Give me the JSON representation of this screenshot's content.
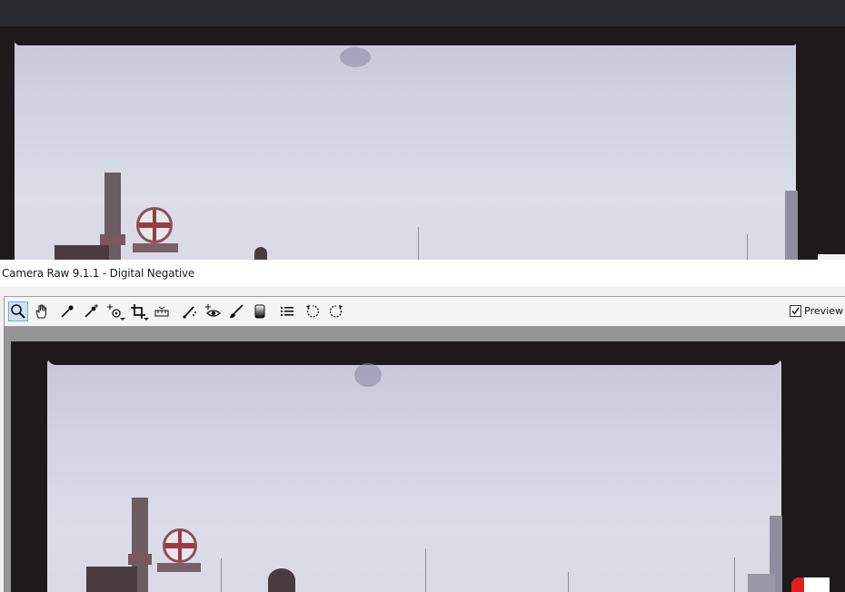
{
  "window": {
    "title": "Camera Raw 9.1.1  -  Digital Negative"
  },
  "toolbar": {
    "tools": [
      {
        "name": "zoom-tool",
        "icon": "magnifier-icon",
        "active": true
      },
      {
        "name": "hand-tool",
        "icon": "hand-icon"
      },
      {
        "name": "white-balance-tool",
        "icon": "eyedropper-icon"
      },
      {
        "name": "color-sampler-tool",
        "icon": "color-sampler-icon"
      },
      {
        "name": "targeted-adjustment-tool",
        "icon": "targeted-adjustment-icon"
      },
      {
        "name": "crop-tool",
        "icon": "crop-icon"
      },
      {
        "name": "straighten-tool",
        "icon": "straighten-icon"
      },
      {
        "name": "spot-removal-tool",
        "icon": "spot-removal-icon"
      },
      {
        "name": "red-eye-removal-tool",
        "icon": "red-eye-icon"
      },
      {
        "name": "adjustment-brush-tool",
        "icon": "brush-icon"
      },
      {
        "name": "graduated-filter-tool",
        "icon": "graduated-filter-icon"
      },
      {
        "name": "preferences-tool",
        "icon": "list-icon"
      },
      {
        "name": "rotate-left-tool",
        "icon": "rotate-ccw-icon"
      },
      {
        "name": "rotate-right-tool",
        "icon": "rotate-cw-icon"
      }
    ],
    "preview_label": "Preview",
    "preview_checked": true
  },
  "colors": {
    "sky": "#d6d7e6",
    "film_border": "#1e1a1b",
    "canvas_bg": "#959596",
    "active_tool": "#cfe1f5"
  }
}
